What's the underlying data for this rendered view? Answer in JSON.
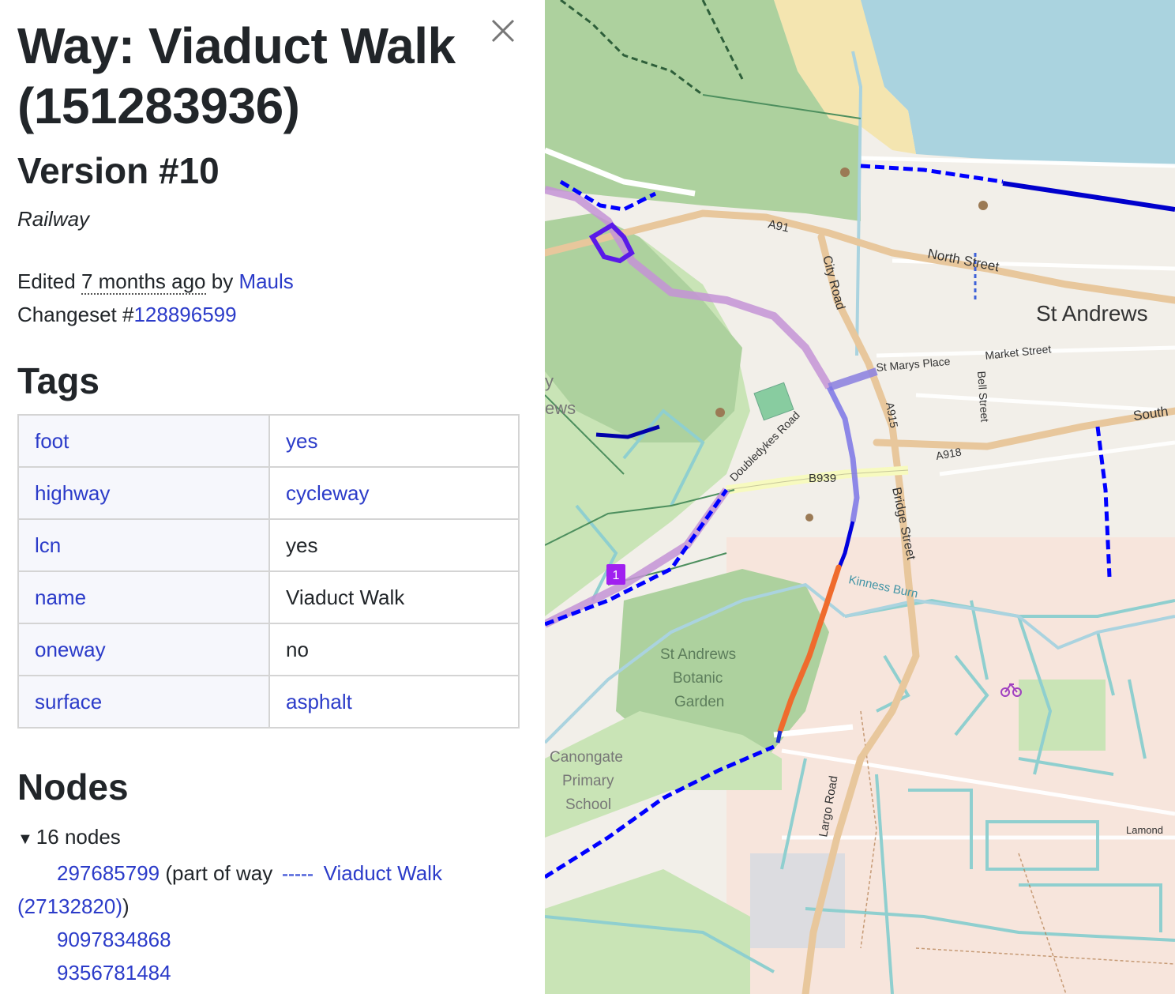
{
  "sidebar": {
    "title": "Way: Viaduct Walk (151283936)",
    "version": "Version #10",
    "kind": "Railway",
    "edited_prefix": "Edited ",
    "edited_ago": "7 months ago",
    "edited_by": " by ",
    "user": "Mauls",
    "changeset_prefix": "Changeset #",
    "changeset_id": "128896599",
    "tags_heading": "Tags",
    "tags": [
      {
        "key": "foot",
        "value": "yes",
        "value_is_link": true
      },
      {
        "key": "highway",
        "value": "cycleway",
        "value_is_link": true
      },
      {
        "key": "lcn",
        "value": "yes",
        "value_is_link": false
      },
      {
        "key": "name",
        "value": "Viaduct Walk",
        "value_is_link": false
      },
      {
        "key": "oneway",
        "value": "no",
        "value_is_link": false
      },
      {
        "key": "surface",
        "value": "asphalt",
        "value_is_link": true
      }
    ],
    "nodes_heading": "Nodes",
    "nodes_summary": "16 nodes",
    "nodes": {
      "first_id": "297685799",
      "part_of_prefix": " (part of way ",
      "part_of_way": "Viaduct Walk",
      "part_of_way_id": "(27132820)",
      "part_of_suffix": ")",
      "others": [
        "9097834868",
        "9356781484"
      ]
    },
    "close_icon": "close-icon"
  },
  "map": {
    "labels": {
      "st_andrews": "St Andrews",
      "north_street": "North Street",
      "a91": "A91",
      "city_road": "City Road",
      "st_marys_place": "St Marys Place",
      "market_street": "Market Street",
      "bell_street": "Bell Street",
      "a915": "A915",
      "a918": "A918",
      "south": "South",
      "b939": "B939",
      "doubledykes_road": "Doubledykes Road",
      "bridge_street": "Bridge Street",
      "kinness_burn": "Kinness Burn",
      "botanic_1": "St Andrews",
      "botanic_2": "Botanic",
      "botanic_3": "Garden",
      "school_1": "Canongate",
      "school_2": "Primary",
      "school_3": "School",
      "largo_road": "Largo Road",
      "lamond": "Lamond",
      "edge_y": "y",
      "edge_ews": "ews",
      "route_badge": "1"
    },
    "colors": {
      "highlight": "#ef6b2d",
      "water": "#aad3df",
      "park": "#add19e",
      "cycleway": "#0000ff",
      "ncn": "#c493d6"
    }
  }
}
